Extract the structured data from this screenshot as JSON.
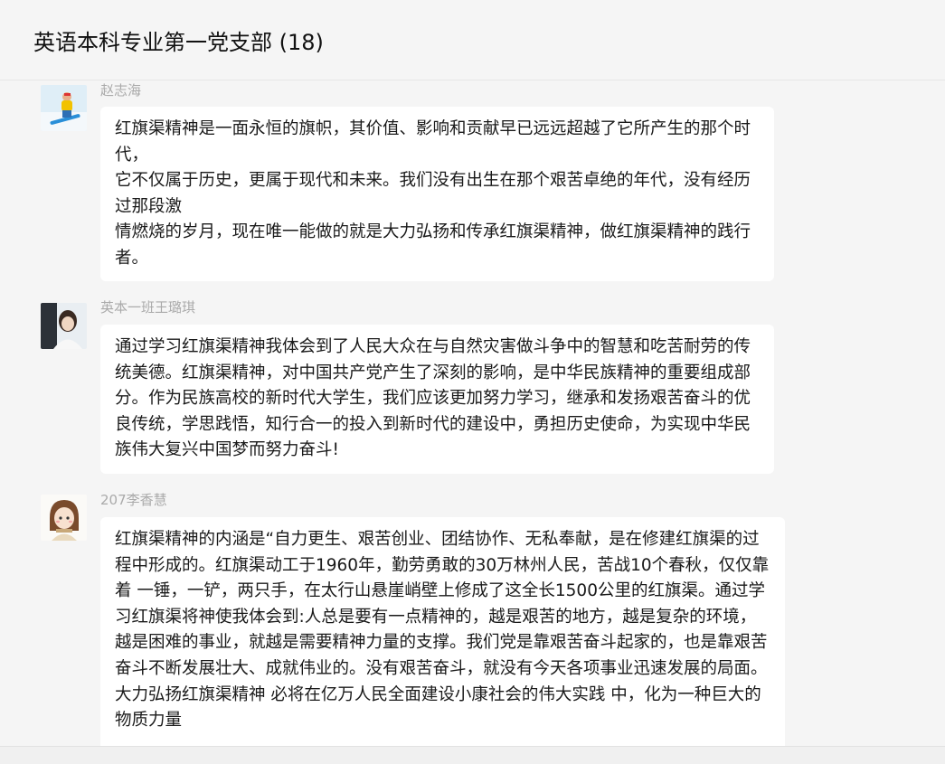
{
  "header": {
    "title": "英语本科专业第一党支部 (18)"
  },
  "messages": [
    {
      "sender": "赵志海",
      "avatar": "snowboarder-avatar",
      "text": "红旗渠精神是一面永恒的旗帜，其价值、影响和贡献早已远远超越了它所产生的那个时代，\n它不仅属于历史，更属于现代和未来。我们没有出生在那个艰苦卓绝的年代，没有经历过那段激\n情燃烧的岁月，现在唯一能做的就是大力弘扬和传承红旗渠精神，做红旗渠精神的践行者。"
    },
    {
      "sender": "英本一班王璐琪",
      "avatar": "photo-avatar",
      "text": "通过学习红旗渠精神我体会到了人民大众在与自然灾害做斗争中的智慧和吃苦耐劳的传统美德。红旗渠精神，对中国共产党产生了深刻的影响，是中华民族精神的重要组成部分。作为民族高校的新时代大学生，我们应该更加努力学习，继承和发扬艰苦奋斗的优良传统，学思践悟，知行合一的投入到新时代的建设中，勇担历史使命，为实现中华民族伟大复兴中国梦而努力奋斗!"
    },
    {
      "sender": "207李香慧",
      "avatar": "cartoon-girl-avatar",
      "text": "红旗渠精神的内涵是“自力更生、艰苦创业、团结协作、无私奉献，是在修建红旗渠的过程中形成的。红旗渠动工于1960年，勤劳勇敢的30万林州人民，苦战10个春秋，仅仅靠着 一锤，一铲，两只手，在太行山悬崖峭壁上修成了这全长1500公里的红旗渠。通过学习红旗渠将神使我体会到:人总是要有一点精神的，越是艰苦的地方，越是复杂的环境，越是困难的事业，就越是需要精神力量的支撑。我们党是靠艰苦奋斗起家的，也是靠艰苦奋斗不断发展壮大、成就伟业的。没有艰苦奋斗，就没有今天各项事业迅速发展的局面。大力弘扬红旗渠精神 必将在亿万人民全面建设小康社会的伟大实践 中，化为一种巨大的物质力量"
    }
  ]
}
